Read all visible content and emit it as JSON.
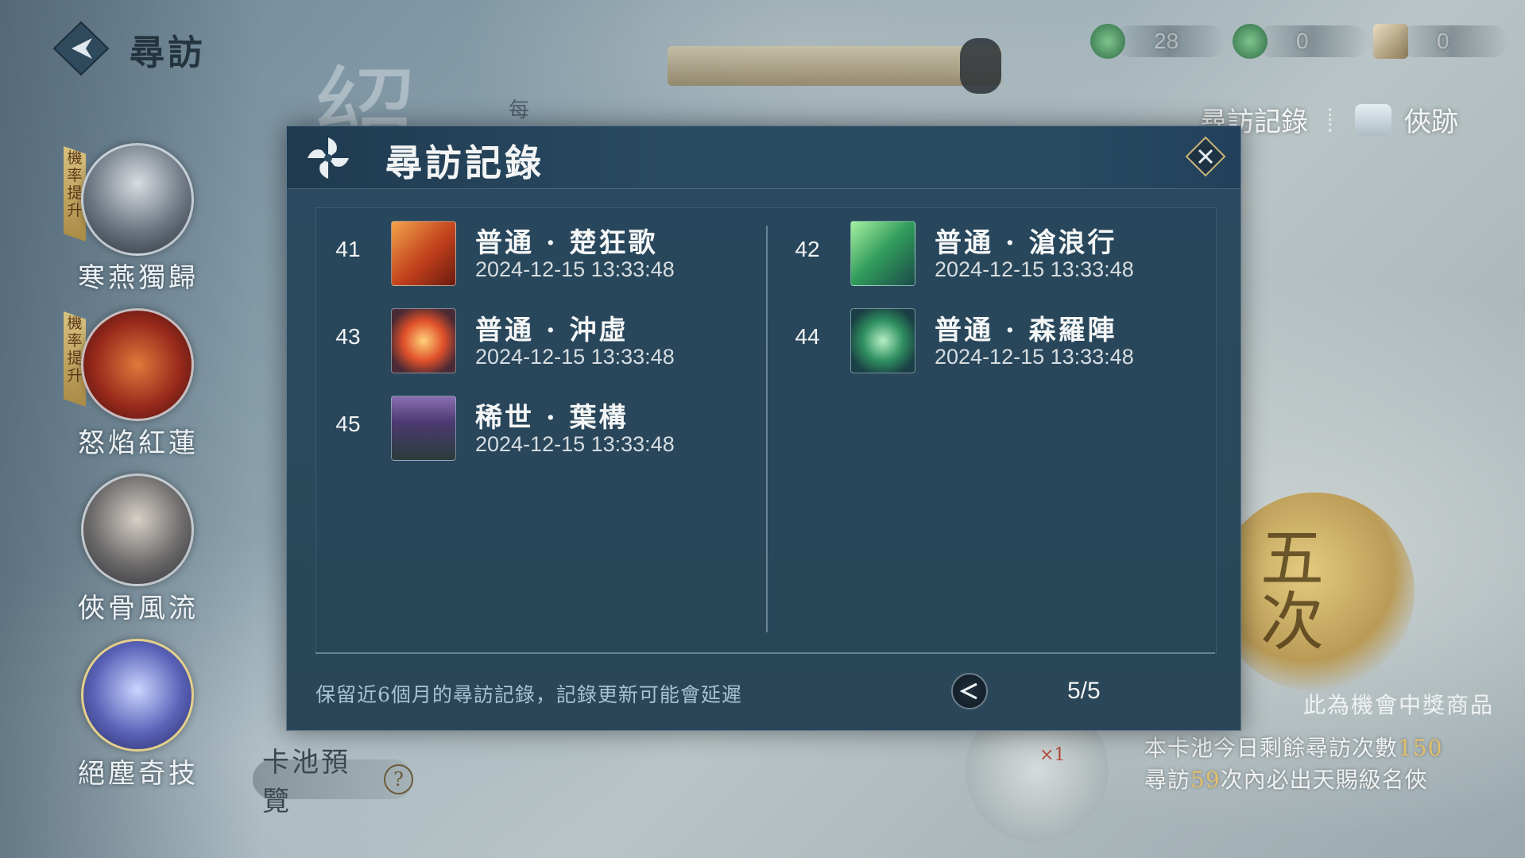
{
  "header": {
    "title": "尋訪",
    "currencies": [
      {
        "icon": "green-jade-plus-icon",
        "value": "28"
      },
      {
        "icon": "green-jade-plus-icon",
        "value": "0"
      },
      {
        "icon": "ticket-scroll-icon",
        "value": "0"
      }
    ],
    "links": {
      "record": "尋訪記錄",
      "trace": "俠跡"
    }
  },
  "sidebar": {
    "characters": [
      {
        "name": "寒燕獨歸",
        "boost": "機率提升"
      },
      {
        "name": "怒焰紅蓮",
        "boost": "機率提升"
      },
      {
        "name": "俠骨風流",
        "boost": ""
      },
      {
        "name": "絕塵奇技",
        "boost": ""
      }
    ],
    "pool_preview": "卡池預覽",
    "pool_help": "?"
  },
  "background": {
    "calligraphy": "紹",
    "calligraphy_small": "每",
    "gold_badge": "五次",
    "item_count": "×1"
  },
  "info": {
    "prize_note": "此為機會中獎商品",
    "remaining_prefix": "本卡池今日剩餘尋訪次數",
    "remaining_value": "150",
    "guarantee_prefix": "尋訪",
    "guarantee_value": "59",
    "guarantee_suffix": "次內必出天賜級名俠"
  },
  "modal": {
    "title": "尋訪記錄",
    "records": [
      {
        "index": "41",
        "name": "普通 · 楚狂歌",
        "time": "2024-12-15 13:33:48",
        "icon": "flaming-sword-icon"
      },
      {
        "index": "42",
        "name": "普通 · 滄浪行",
        "time": "2024-12-15 13:33:48",
        "icon": "green-wind-blade-icon"
      },
      {
        "index": "43",
        "name": "普通 · 沖虛",
        "time": "2024-12-15 13:33:48",
        "icon": "fire-orb-icon"
      },
      {
        "index": "44",
        "name": "普通 · 森羅陣",
        "time": "2024-12-15 13:33:48",
        "icon": "jade-orb-icon"
      },
      {
        "index": "45",
        "name": "稀世 · 葉構",
        "time": "2024-12-15 13:33:48",
        "icon": "character-portrait-icon"
      }
    ],
    "footer_note": "保留近6個月的尋訪記錄，記錄更新可能會延遲",
    "page": "5/5"
  },
  "colors": {
    "modal_bg": "#2a4658",
    "highlight": "#e2c06b",
    "text": "#f3f5f5"
  }
}
